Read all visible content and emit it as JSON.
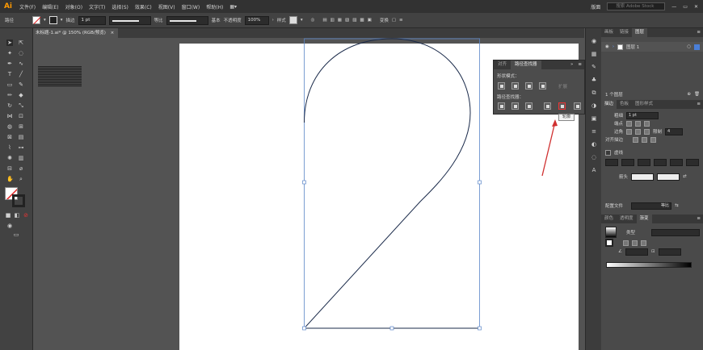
{
  "app": {
    "logo": "Ai",
    "menus": [
      "文件(F)",
      "编辑(E)",
      "对象(O)",
      "文字(T)",
      "选择(S)",
      "效果(C)",
      "视图(V)",
      "窗口(W)",
      "帮助(H)"
    ],
    "layout": "版面",
    "search_placeholder": "搜索 Adobe Stock"
  },
  "control_bar": {
    "selection": "路径",
    "stroke_label": "描边",
    "stroke_weight": "1 pt",
    "profile_label": "等比",
    "brush_label": "基本",
    "opacity_label": "不透明度",
    "opacity_value": "100%",
    "style_label": "样式",
    "transform_label": "变换"
  },
  "document": {
    "tab_title": "未标题-1.ai* @ 150% (RGB/预览)",
    "close": "×"
  },
  "pathfinder_panel": {
    "tabs": [
      "对齐",
      "路径查找器"
    ],
    "active_tab": 1,
    "shape_modes_label": "形状模式：",
    "expand_label": "扩展",
    "pathfinders_label": "路径查找器：",
    "tooltip": "轮廓"
  },
  "layers_panel": {
    "tabs": [
      "画板",
      "链接",
      "图层"
    ],
    "active_tab": 2,
    "layer_name": "图层 1",
    "footer": "1 个图层"
  },
  "stroke_panel": {
    "tabs": [
      "描边",
      "色板",
      "图形样式"
    ],
    "active_tab": 0,
    "weight_label": "粗细",
    "weight_value": "1 pt",
    "cap_label": "端点",
    "corner_label": "边角",
    "limit_label": "限制",
    "limit_value": "4",
    "align_label": "对齐描边",
    "dashed_label": "虚线",
    "arrow_label": "箭头",
    "profile_label": "配置文件",
    "profile_value": "等比"
  },
  "gradient_panel": {
    "tabs": [
      "颜色",
      "透明度",
      "渐变"
    ],
    "active_tab": 2,
    "type_label": "类型"
  },
  "colors": {
    "accent_red": "#e33b3b",
    "path": "#1a2a4a",
    "bbox": "#5b86c8"
  }
}
